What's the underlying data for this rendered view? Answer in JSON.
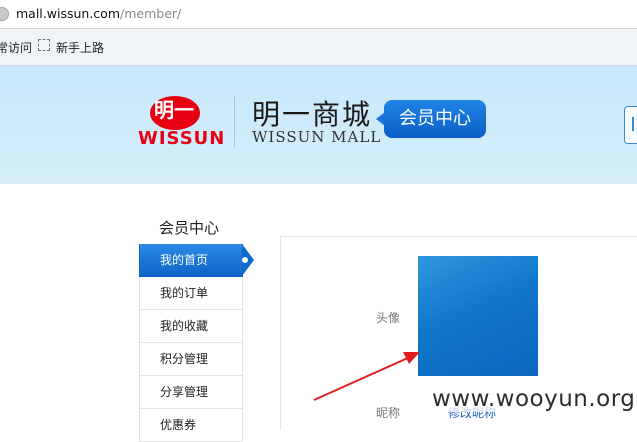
{
  "browser": {
    "url_host": "mall.wissun.com",
    "url_path": "/member/",
    "bookmarks": [
      {
        "label": "常访问"
      },
      {
        "label": "新手上路"
      }
    ]
  },
  "header": {
    "logo_mark": "明一",
    "logo_latin": "WISSUN",
    "brand_cn": "明一商城",
    "brand_en": "WISSUN MALL",
    "badge": "会员中心"
  },
  "sidebar": {
    "title": "会员中心",
    "items": [
      {
        "label": "我的首页",
        "active": true
      },
      {
        "label": "我的订单"
      },
      {
        "label": "我的收藏"
      },
      {
        "label": "积分管理"
      },
      {
        "label": "分享管理"
      },
      {
        "label": "优惠券"
      }
    ]
  },
  "profile": {
    "avatar_label": "头像",
    "nickname_label": "昵称",
    "nickname_action": "修改昵称"
  },
  "watermark": "www.wooyun.org",
  "colors": {
    "accent": "#0d64c8",
    "brand_red": "#e60012",
    "annotation_arrow": "#e02020"
  }
}
